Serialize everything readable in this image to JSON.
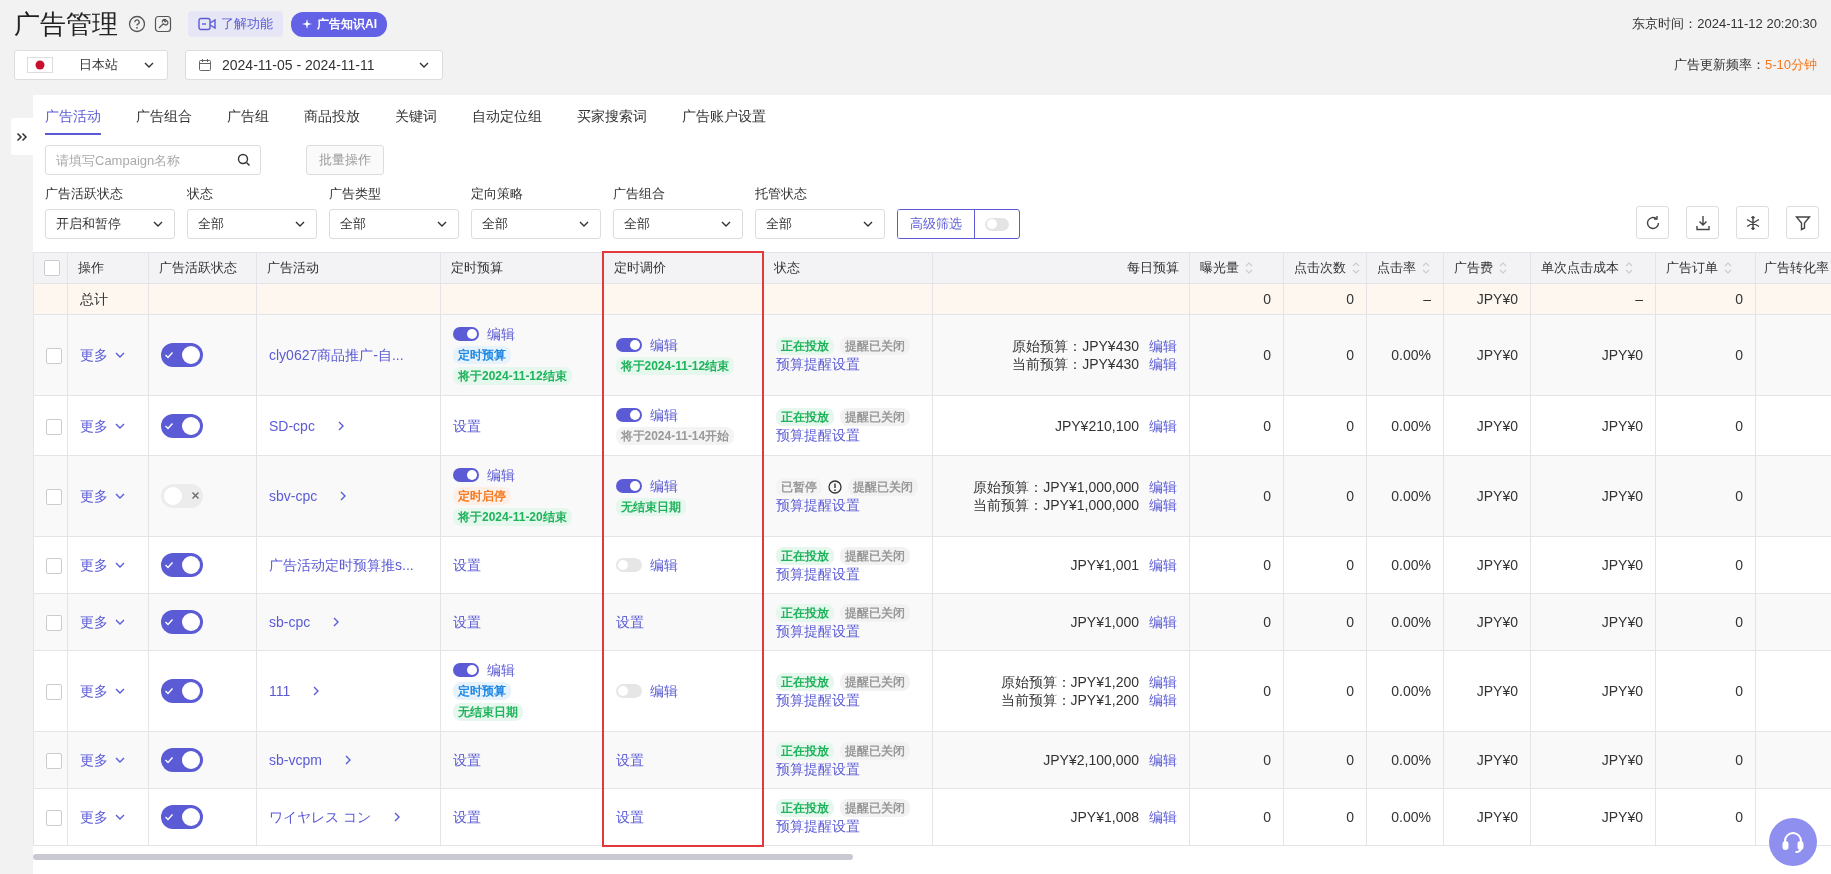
{
  "header": {
    "title": "广告管理",
    "learn_button": "了解功能",
    "ai_button": "广告知识AI",
    "time": "东京时间：2024-11-12 20:20:30",
    "region": "日本站",
    "date_range": "2024-11-05 - 2024-11-11",
    "update_label": "广告更新频率：",
    "update_value": "5-10分钟"
  },
  "tabs": [
    {
      "label": "广告活动",
      "selected": true
    },
    {
      "label": "广告组合",
      "selected": false
    },
    {
      "label": "广告组",
      "selected": false
    },
    {
      "label": "商品投放",
      "selected": false
    },
    {
      "label": "关键词",
      "selected": false
    },
    {
      "label": "自动定位组",
      "selected": false
    },
    {
      "label": "买家搜索词",
      "selected": false
    },
    {
      "label": "广告账户设置",
      "selected": false
    }
  ],
  "search": {
    "placeholder": "请填写Campaign名称"
  },
  "bulk_button": "批量操作",
  "filters": [
    {
      "label": "广告活跃状态",
      "value": "开启和暂停"
    },
    {
      "label": "状态",
      "value": "全部"
    },
    {
      "label": "广告类型",
      "value": "全部"
    },
    {
      "label": "定向策略",
      "value": "全部"
    },
    {
      "label": "广告组合",
      "value": "全部"
    },
    {
      "label": "托管状态",
      "value": "全部"
    }
  ],
  "advanced_filter": {
    "label": "高级筛选",
    "on": false
  },
  "table": {
    "header_checked": false,
    "columns": [
      {
        "label": "操作",
        "sortable": false,
        "highlighted": false
      },
      {
        "label": "广告活跃状态",
        "sortable": false,
        "highlighted": false
      },
      {
        "label": "广告活动",
        "sortable": false,
        "highlighted": false
      },
      {
        "label": "定时预算",
        "sortable": false,
        "highlighted": false
      },
      {
        "label": "定时调价",
        "sortable": false,
        "highlighted": true
      },
      {
        "label": "状态",
        "sortable": false,
        "highlighted": false
      },
      {
        "label": "每日预算",
        "sortable": false,
        "highlighted": false
      },
      {
        "label": "曝光量",
        "sortable": true,
        "highlighted": false
      },
      {
        "label": "点击次数",
        "sortable": true,
        "highlighted": false
      },
      {
        "label": "点击率",
        "sortable": true,
        "highlighted": false
      },
      {
        "label": "广告费",
        "sortable": true,
        "highlighted": false
      },
      {
        "label": "单次点击成本",
        "sortable": true,
        "highlighted": false
      },
      {
        "label": "广告订单",
        "sortable": true,
        "highlighted": false
      },
      {
        "label": "广告转化率",
        "highlighted": false
      }
    ],
    "total": {
      "label": "总计",
      "metrics": [
        "0",
        "0",
        "–",
        "JPY¥0",
        "–",
        "0"
      ]
    },
    "rows": [
      {
        "checked": false,
        "action": "更多",
        "active": true,
        "campaign": "cly0627商品推广-自...",
        "chevron": false,
        "budget_schedule": {
          "kind": "editor",
          "on": true,
          "action": "编辑",
          "tags": [
            {
              "text": "定时预算",
              "color": "#1e88e5"
            },
            {
              "text": "将于2024-11-12结束",
              "color": "#1fb35c"
            }
          ]
        },
        "price_schedule": {
          "kind": "editor",
          "on": true,
          "action": "编辑",
          "tags": [
            {
              "text": "将于2024-11-12结束",
              "color": "#1fb35c"
            }
          ]
        },
        "status": {
          "label": "正在投放",
          "color": "#1fb35c",
          "warning": false,
          "alert": "提醒已关闭",
          "link": "预算提醒设置"
        },
        "daily_budget": [
          {
            "text": "原始预算：JPY¥430",
            "action": "编辑"
          },
          {
            "text": "当前预算：JPY¥430",
            "action": "编辑"
          }
        ],
        "metrics": [
          "0",
          "0",
          "0.00%",
          "JPY¥0",
          "JPY¥0",
          "0"
        ]
      },
      {
        "checked": false,
        "action": "更多",
        "active": true,
        "campaign": "SD-cpc",
        "chevron": true,
        "budget_schedule": {
          "kind": "link",
          "action": "设置"
        },
        "price_schedule": {
          "kind": "editor",
          "on": true,
          "action": "编辑",
          "tags": [
            {
              "text": "将于2024-11-14开始",
              "color": "#999999"
            }
          ]
        },
        "status": {
          "label": "正在投放",
          "color": "#1fb35c",
          "warning": false,
          "alert": "提醒已关闭",
          "link": "预算提醒设置"
        },
        "daily_budget": [
          {
            "text": "JPY¥210,100",
            "action": "编辑"
          }
        ],
        "metrics": [
          "0",
          "0",
          "0.00%",
          "JPY¥0",
          "JPY¥0",
          "0"
        ]
      },
      {
        "checked": false,
        "action": "更多",
        "active": false,
        "campaign": "sbv-cpc",
        "chevron": true,
        "budget_schedule": {
          "kind": "editor",
          "on": true,
          "action": "编辑",
          "tags": [
            {
              "text": "定时启停",
              "color": "#f5781e"
            },
            {
              "text": "将于2024-11-20结束",
              "color": "#1fb35c"
            }
          ]
        },
        "price_schedule": {
          "kind": "editor",
          "on": true,
          "action": "编辑",
          "tags": [
            {
              "text": "无结束日期",
              "color": "#1fb35c"
            }
          ]
        },
        "status": {
          "label": "已暂停",
          "color": "#999999",
          "warning": true,
          "alert": "提醒已关闭",
          "link": "预算提醒设置"
        },
        "daily_budget": [
          {
            "text": "原始预算：JPY¥1,000,000",
            "action": "编辑"
          },
          {
            "text": "当前预算：JPY¥1,000,000",
            "action": "编辑"
          }
        ],
        "metrics": [
          "0",
          "0",
          "0.00%",
          "JPY¥0",
          "JPY¥0",
          "0"
        ]
      },
      {
        "checked": false,
        "action": "更多",
        "active": true,
        "campaign": "广告活动定时预算推s...",
        "chevron": false,
        "budget_schedule": {
          "kind": "link",
          "action": "设置"
        },
        "price_schedule": {
          "kind": "editor",
          "on": false,
          "action": "编辑"
        },
        "status": {
          "label": "正在投放",
          "color": "#1fb35c",
          "warning": false,
          "alert": "提醒已关闭",
          "link": "预算提醒设置"
        },
        "daily_budget": [
          {
            "text": "JPY¥1,001",
            "action": "编辑"
          }
        ],
        "metrics": [
          "0",
          "0",
          "0.00%",
          "JPY¥0",
          "JPY¥0",
          "0"
        ]
      },
      {
        "checked": false,
        "action": "更多",
        "active": true,
        "campaign": "sb-cpc",
        "chevron": true,
        "budget_schedule": {
          "kind": "link",
          "action": "设置"
        },
        "price_schedule": {
          "kind": "link",
          "action": "设置"
        },
        "status": {
          "label": "正在投放",
          "color": "#1fb35c",
          "warning": false,
          "alert": "提醒已关闭",
          "link": "预算提醒设置"
        },
        "daily_budget": [
          {
            "text": "JPY¥1,000",
            "action": "编辑"
          }
        ],
        "metrics": [
          "0",
          "0",
          "0.00%",
          "JPY¥0",
          "JPY¥0",
          "0"
        ]
      },
      {
        "checked": false,
        "action": "更多",
        "active": true,
        "campaign": "111",
        "chevron": true,
        "budget_schedule": {
          "kind": "editor",
          "on": true,
          "action": "编辑",
          "tags": [
            {
              "text": "定时预算",
              "color": "#1e88e5"
            },
            {
              "text": "无结束日期",
              "color": "#1fb35c"
            }
          ]
        },
        "price_schedule": {
          "kind": "editor",
          "on": false,
          "action": "编辑"
        },
        "status": {
          "label": "正在投放",
          "color": "#1fb35c",
          "warning": false,
          "alert": "提醒已关闭",
          "link": "预算提醒设置"
        },
        "daily_budget": [
          {
            "text": "原始预算：JPY¥1,200",
            "action": "编辑"
          },
          {
            "text": "当前预算：JPY¥1,200",
            "action": "编辑"
          }
        ],
        "metrics": [
          "0",
          "0",
          "0.00%",
          "JPY¥0",
          "JPY¥0",
          "0"
        ]
      },
      {
        "checked": false,
        "action": "更多",
        "active": true,
        "campaign": "sb-vcpm",
        "chevron": true,
        "budget_schedule": {
          "kind": "link",
          "action": "设置"
        },
        "price_schedule": {
          "kind": "link",
          "action": "设置"
        },
        "status": {
          "label": "正在投放",
          "color": "#1fb35c",
          "warning": false,
          "alert": "提醒已关闭",
          "link": "预算提醒设置"
        },
        "daily_budget": [
          {
            "text": "JPY¥2,100,000",
            "action": "编辑"
          }
        ],
        "metrics": [
          "0",
          "0",
          "0.00%",
          "JPY¥0",
          "JPY¥0",
          "0"
        ]
      },
      {
        "checked": false,
        "action": "更多",
        "active": true,
        "campaign": "ワイヤレス コン",
        "chevron": true,
        "budget_schedule": {
          "kind": "link",
          "action": "设置"
        },
        "price_schedule": {
          "kind": "link",
          "action": "设置"
        },
        "status": {
          "label": "正在投放",
          "color": "#1fb35c",
          "warning": false,
          "alert": "提醒已关闭",
          "link": "预算提醒设置"
        },
        "daily_budget": [
          {
            "text": "JPY¥1,008",
            "action": "编辑"
          }
        ],
        "metrics": [
          "0",
          "0",
          "0.00%",
          "JPY¥0",
          "JPY¥0",
          "0"
        ]
      }
    ]
  }
}
